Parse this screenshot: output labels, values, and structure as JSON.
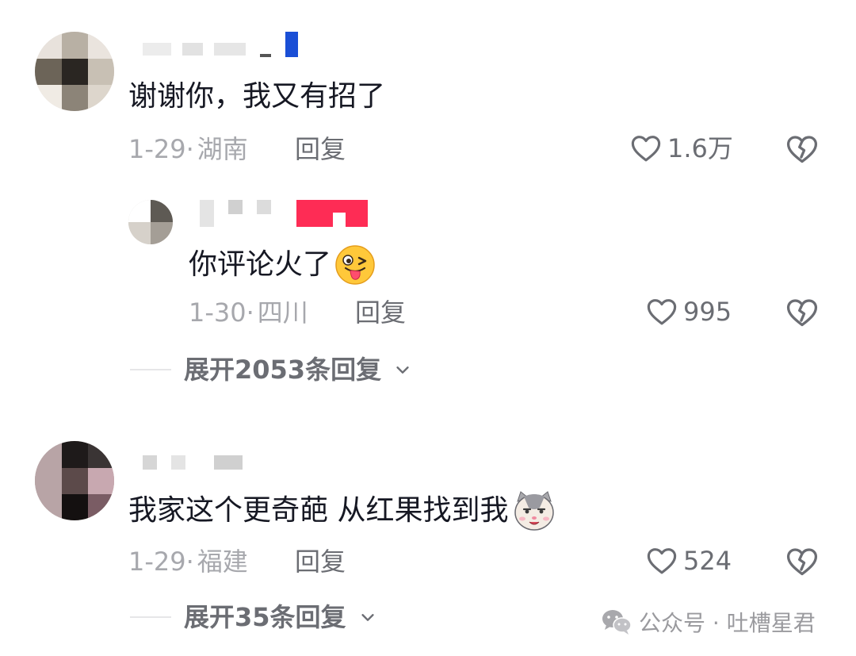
{
  "comments": [
    {
      "text": "谢谢你，我又有招了",
      "date": "1-29",
      "sep": "·",
      "location": "湖南",
      "reply_label": "回复",
      "likes": "1.6万",
      "replies": [
        {
          "text": "你评论火了",
          "emoji": "wink-tongue-emoji",
          "date": "1-30",
          "sep": "·",
          "location": "四川",
          "reply_label": "回复",
          "likes": "995"
        }
      ],
      "expand_label": "展开2053条回复"
    },
    {
      "text": "我家这个更奇葩 从红果找到我",
      "emoji": "cat-face-emoji",
      "date": "1-29",
      "sep": "·",
      "location": "福建",
      "reply_label": "回复",
      "likes": "524",
      "expand_label": "展开35条回复"
    }
  ],
  "watermark": {
    "icon": "wechat-icon",
    "text": "公众号 · 吐槽星君"
  },
  "colors": {
    "text": "#161823",
    "meta": "#a7a8ad",
    "action": "#6b6d73",
    "name_redaction_blue": "#1a4fd6",
    "name_redaction_pink": "#fe2c55"
  }
}
